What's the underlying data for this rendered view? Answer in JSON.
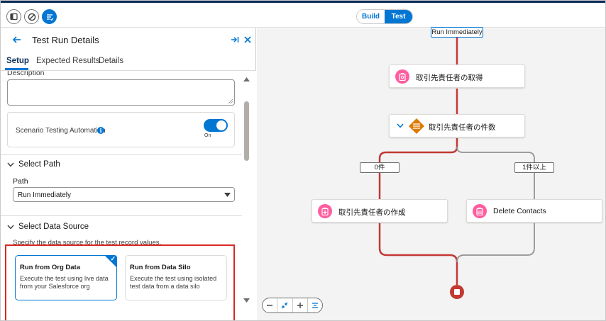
{
  "header": {
    "mode_build": "Build",
    "mode_test": "Test",
    "active_mode": "Test"
  },
  "panel": {
    "title": "Test Run Details",
    "tabs": [
      "Setup",
      "Expected Results",
      "Details"
    ],
    "active_tab": "Setup",
    "description_label": "Description",
    "automation": {
      "label": "Scenario Testing Automation",
      "toggle_state": "On",
      "enabled": true
    },
    "select_path": {
      "heading": "Select Path",
      "field_label": "Path",
      "selected": "Run Immediately"
    },
    "data_source": {
      "heading": "Select Data Source",
      "description": "Specify the data source for the test record values.",
      "options": [
        {
          "title": "Run from Org Data",
          "desc": "Execute the test using live data from your Salesforce org",
          "selected": true
        },
        {
          "title": "Run from Data Silo",
          "desc": "Execute the test using isolated test data from a data silo",
          "selected": false
        }
      ]
    }
  },
  "canvas": {
    "start_label": "Run Immediately",
    "nodes": {
      "get": "取引先責任者の取得",
      "decision": "取引先責任者の件数",
      "create": "取引先責任者の作成",
      "delete": "Delete Contacts"
    },
    "branches": {
      "left": "0件",
      "right": "1件以上"
    },
    "active_path_color": "#c23934",
    "inactive_path_color": "#939393"
  },
  "colors": {
    "accent": "#0176d3",
    "highlight_box": "#d9281f",
    "record_icon": "#ff5d9f",
    "decision_icon": "#dd7a01"
  }
}
